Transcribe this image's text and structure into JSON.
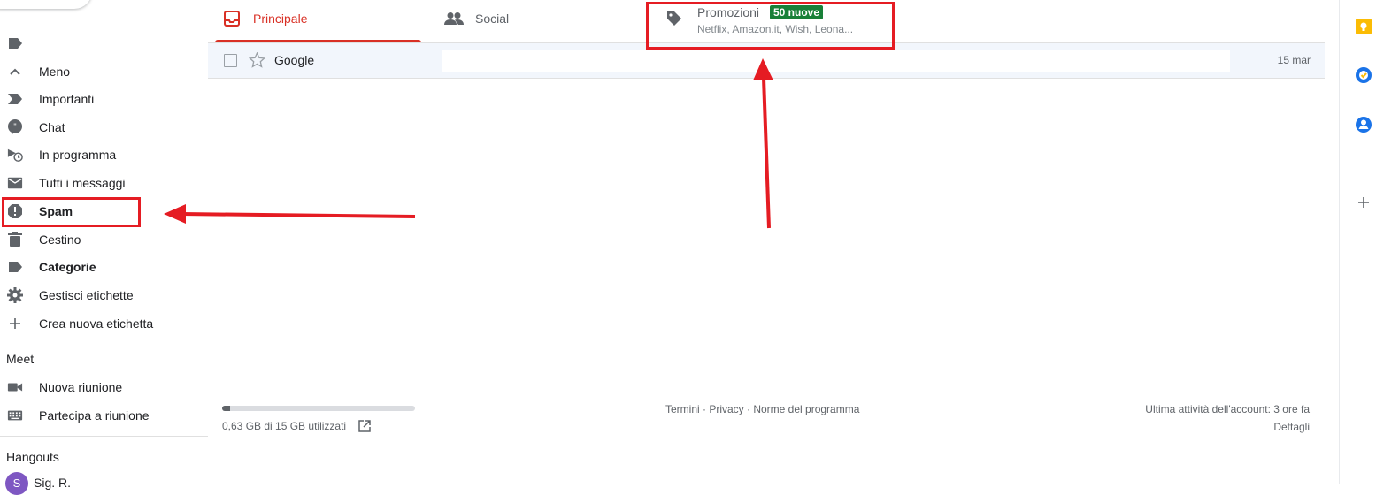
{
  "sidebar": {
    "items": [
      {
        "label": "",
        "icon": "label-icon"
      },
      {
        "label": "Meno",
        "icon": "chevron-up-icon"
      },
      {
        "label": "Importanti",
        "icon": "important-icon"
      },
      {
        "label": "Chat",
        "icon": "chat-icon"
      },
      {
        "label": "In programma",
        "icon": "scheduled-icon"
      },
      {
        "label": "Tutti i messaggi",
        "icon": "mail-icon"
      },
      {
        "label": "Spam",
        "icon": "spam-icon"
      },
      {
        "label": "Cestino",
        "icon": "trash-icon"
      },
      {
        "label": "Categorie",
        "icon": "label-icon"
      },
      {
        "label": "Gestisci etichette",
        "icon": "gear-icon"
      },
      {
        "label": "Crea nuova etichetta",
        "icon": "plus-icon"
      }
    ],
    "meet": {
      "heading": "Meet",
      "items": [
        {
          "label": "Nuova riunione",
          "icon": "video-icon"
        },
        {
          "label": "Partecipa a riunione",
          "icon": "keyboard-icon"
        }
      ]
    },
    "hangouts": {
      "heading": "Hangouts",
      "contact_name": "Sig. R.",
      "contact_initial": "S"
    }
  },
  "tabs": [
    {
      "label": "Principale",
      "icon": "inbox-icon",
      "active": true
    },
    {
      "label": "Social",
      "icon": "people-icon"
    },
    {
      "label": "Promozioni",
      "icon": "tag-icon",
      "badge": "50 nuove",
      "subtitle": "Netflix, Amazon.it, Wish, Leona..."
    }
  ],
  "emails": [
    {
      "sender": "Google",
      "date": "15 mar",
      "starred": false
    }
  ],
  "footer": {
    "storage_text": "0,63 GB di 15 GB utilizzati",
    "storage_fraction": 0.042,
    "links": "Termini · Privacy · Norme del programma",
    "activity": "Ultima attività dell'account: 3 ore fa",
    "details": "Dettagli"
  },
  "colors": {
    "accent_red": "#d93025",
    "annotation_red": "#e51c23",
    "badge_green": "#188038",
    "keep_yellow": "#fbbc04",
    "tasks_blue": "#1a73e8",
    "contacts_blue": "#1a73e8"
  },
  "right_rail": [
    "keep-icon",
    "tasks-icon",
    "contacts-icon",
    "add-icon"
  ]
}
